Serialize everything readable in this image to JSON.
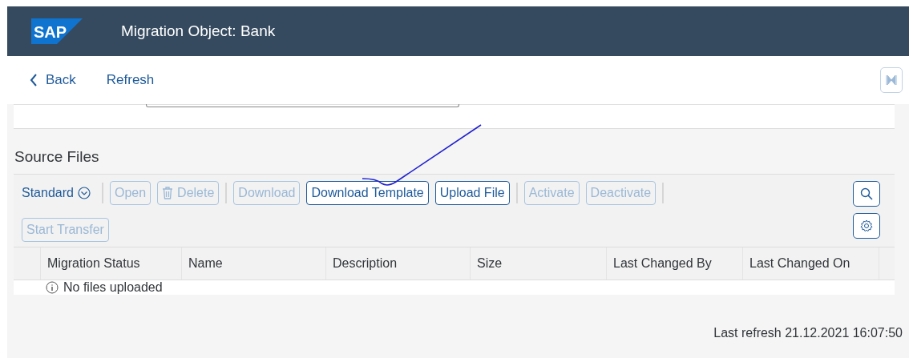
{
  "header": {
    "logo": "SAP",
    "title": "Migration Object: Bank"
  },
  "nav": [
    {
      "label": "Back",
      "kind": "back"
    },
    {
      "label": "Refresh",
      "kind": "link"
    }
  ],
  "section": {
    "title": "Source Files"
  },
  "toolbar": {
    "variant": "Standard",
    "items": [
      {
        "kind": "separator"
      },
      {
        "kind": "button",
        "label": "Open",
        "disabled": true
      },
      {
        "kind": "trash_button",
        "label": "Delete",
        "disabled": true
      },
      {
        "kind": "separator"
      },
      {
        "kind": "button",
        "label": "Download",
        "disabled": true
      },
      {
        "kind": "button",
        "label": "Download Template",
        "disabled": false
      },
      {
        "kind": "button",
        "label": "Upload File",
        "disabled": false
      },
      {
        "kind": "separator"
      },
      {
        "kind": "button",
        "label": "Activate",
        "disabled": true
      },
      {
        "kind": "button",
        "label": "Deactivate",
        "disabled": true
      },
      {
        "kind": "separator"
      },
      {
        "kind": "break"
      },
      {
        "kind": "button",
        "label": "Start Transfer",
        "disabled": true
      }
    ]
  },
  "table": {
    "columns": [
      "Migration Status",
      "Name",
      "Description",
      "Size",
      "Last Changed By",
      "Last Changed On"
    ],
    "empty_text": "No files uploaded"
  },
  "footer": {
    "text": "Last refresh 21.12.2021 16:07:50"
  }
}
